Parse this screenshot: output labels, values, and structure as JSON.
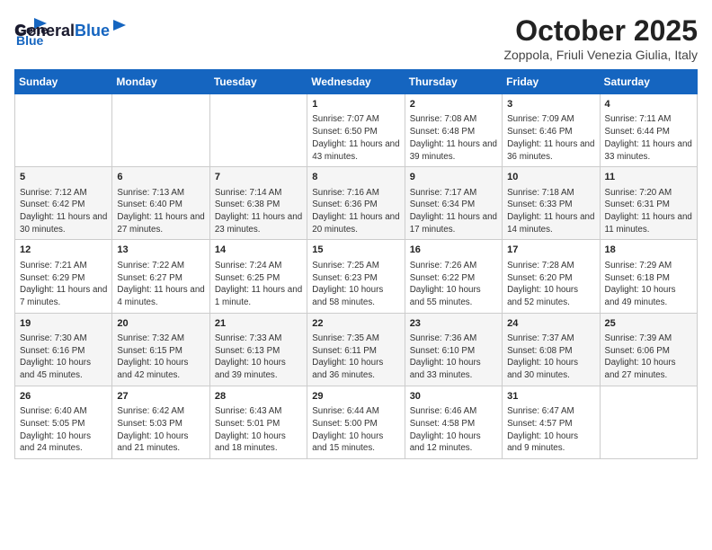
{
  "header": {
    "logo_general": "General",
    "logo_blue": "Blue",
    "month_title": "October 2025",
    "subtitle": "Zoppola, Friuli Venezia Giulia, Italy"
  },
  "days_of_week": [
    "Sunday",
    "Monday",
    "Tuesday",
    "Wednesday",
    "Thursday",
    "Friday",
    "Saturday"
  ],
  "weeks": [
    [
      {
        "day": "",
        "content": ""
      },
      {
        "day": "",
        "content": ""
      },
      {
        "day": "",
        "content": ""
      },
      {
        "day": "1",
        "content": "Sunrise: 7:07 AM\nSunset: 6:50 PM\nDaylight: 11 hours and 43 minutes."
      },
      {
        "day": "2",
        "content": "Sunrise: 7:08 AM\nSunset: 6:48 PM\nDaylight: 11 hours and 39 minutes."
      },
      {
        "day": "3",
        "content": "Sunrise: 7:09 AM\nSunset: 6:46 PM\nDaylight: 11 hours and 36 minutes."
      },
      {
        "day": "4",
        "content": "Sunrise: 7:11 AM\nSunset: 6:44 PM\nDaylight: 11 hours and 33 minutes."
      }
    ],
    [
      {
        "day": "5",
        "content": "Sunrise: 7:12 AM\nSunset: 6:42 PM\nDaylight: 11 hours and 30 minutes."
      },
      {
        "day": "6",
        "content": "Sunrise: 7:13 AM\nSunset: 6:40 PM\nDaylight: 11 hours and 27 minutes."
      },
      {
        "day": "7",
        "content": "Sunrise: 7:14 AM\nSunset: 6:38 PM\nDaylight: 11 hours and 23 minutes."
      },
      {
        "day": "8",
        "content": "Sunrise: 7:16 AM\nSunset: 6:36 PM\nDaylight: 11 hours and 20 minutes."
      },
      {
        "day": "9",
        "content": "Sunrise: 7:17 AM\nSunset: 6:34 PM\nDaylight: 11 hours and 17 minutes."
      },
      {
        "day": "10",
        "content": "Sunrise: 7:18 AM\nSunset: 6:33 PM\nDaylight: 11 hours and 14 minutes."
      },
      {
        "day": "11",
        "content": "Sunrise: 7:20 AM\nSunset: 6:31 PM\nDaylight: 11 hours and 11 minutes."
      }
    ],
    [
      {
        "day": "12",
        "content": "Sunrise: 7:21 AM\nSunset: 6:29 PM\nDaylight: 11 hours and 7 minutes."
      },
      {
        "day": "13",
        "content": "Sunrise: 7:22 AM\nSunset: 6:27 PM\nDaylight: 11 hours and 4 minutes."
      },
      {
        "day": "14",
        "content": "Sunrise: 7:24 AM\nSunset: 6:25 PM\nDaylight: 11 hours and 1 minute."
      },
      {
        "day": "15",
        "content": "Sunrise: 7:25 AM\nSunset: 6:23 PM\nDaylight: 10 hours and 58 minutes."
      },
      {
        "day": "16",
        "content": "Sunrise: 7:26 AM\nSunset: 6:22 PM\nDaylight: 10 hours and 55 minutes."
      },
      {
        "day": "17",
        "content": "Sunrise: 7:28 AM\nSunset: 6:20 PM\nDaylight: 10 hours and 52 minutes."
      },
      {
        "day": "18",
        "content": "Sunrise: 7:29 AM\nSunset: 6:18 PM\nDaylight: 10 hours and 49 minutes."
      }
    ],
    [
      {
        "day": "19",
        "content": "Sunrise: 7:30 AM\nSunset: 6:16 PM\nDaylight: 10 hours and 45 minutes."
      },
      {
        "day": "20",
        "content": "Sunrise: 7:32 AM\nSunset: 6:15 PM\nDaylight: 10 hours and 42 minutes."
      },
      {
        "day": "21",
        "content": "Sunrise: 7:33 AM\nSunset: 6:13 PM\nDaylight: 10 hours and 39 minutes."
      },
      {
        "day": "22",
        "content": "Sunrise: 7:35 AM\nSunset: 6:11 PM\nDaylight: 10 hours and 36 minutes."
      },
      {
        "day": "23",
        "content": "Sunrise: 7:36 AM\nSunset: 6:10 PM\nDaylight: 10 hours and 33 minutes."
      },
      {
        "day": "24",
        "content": "Sunrise: 7:37 AM\nSunset: 6:08 PM\nDaylight: 10 hours and 30 minutes."
      },
      {
        "day": "25",
        "content": "Sunrise: 7:39 AM\nSunset: 6:06 PM\nDaylight: 10 hours and 27 minutes."
      }
    ],
    [
      {
        "day": "26",
        "content": "Sunrise: 6:40 AM\nSunset: 5:05 PM\nDaylight: 10 hours and 24 minutes."
      },
      {
        "day": "27",
        "content": "Sunrise: 6:42 AM\nSunset: 5:03 PM\nDaylight: 10 hours and 21 minutes."
      },
      {
        "day": "28",
        "content": "Sunrise: 6:43 AM\nSunset: 5:01 PM\nDaylight: 10 hours and 18 minutes."
      },
      {
        "day": "29",
        "content": "Sunrise: 6:44 AM\nSunset: 5:00 PM\nDaylight: 10 hours and 15 minutes."
      },
      {
        "day": "30",
        "content": "Sunrise: 6:46 AM\nSunset: 4:58 PM\nDaylight: 10 hours and 12 minutes."
      },
      {
        "day": "31",
        "content": "Sunrise: 6:47 AM\nSunset: 4:57 PM\nDaylight: 10 hours and 9 minutes."
      },
      {
        "day": "",
        "content": ""
      }
    ]
  ]
}
